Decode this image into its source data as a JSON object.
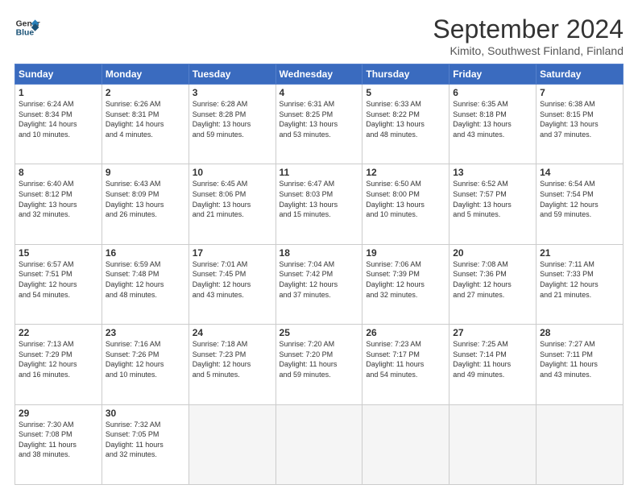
{
  "header": {
    "logo_line1": "General",
    "logo_line2": "Blue",
    "month_title": "September 2024",
    "subtitle": "Kimito, Southwest Finland, Finland"
  },
  "days_of_week": [
    "Sunday",
    "Monday",
    "Tuesday",
    "Wednesday",
    "Thursday",
    "Friday",
    "Saturday"
  ],
  "weeks": [
    [
      {
        "num": "1",
        "info": "Sunrise: 6:24 AM\nSunset: 8:34 PM\nDaylight: 14 hours\nand 10 minutes."
      },
      {
        "num": "2",
        "info": "Sunrise: 6:26 AM\nSunset: 8:31 PM\nDaylight: 14 hours\nand 4 minutes."
      },
      {
        "num": "3",
        "info": "Sunrise: 6:28 AM\nSunset: 8:28 PM\nDaylight: 13 hours\nand 59 minutes."
      },
      {
        "num": "4",
        "info": "Sunrise: 6:31 AM\nSunset: 8:25 PM\nDaylight: 13 hours\nand 53 minutes."
      },
      {
        "num": "5",
        "info": "Sunrise: 6:33 AM\nSunset: 8:22 PM\nDaylight: 13 hours\nand 48 minutes."
      },
      {
        "num": "6",
        "info": "Sunrise: 6:35 AM\nSunset: 8:18 PM\nDaylight: 13 hours\nand 43 minutes."
      },
      {
        "num": "7",
        "info": "Sunrise: 6:38 AM\nSunset: 8:15 PM\nDaylight: 13 hours\nand 37 minutes."
      }
    ],
    [
      {
        "num": "8",
        "info": "Sunrise: 6:40 AM\nSunset: 8:12 PM\nDaylight: 13 hours\nand 32 minutes."
      },
      {
        "num": "9",
        "info": "Sunrise: 6:43 AM\nSunset: 8:09 PM\nDaylight: 13 hours\nand 26 minutes."
      },
      {
        "num": "10",
        "info": "Sunrise: 6:45 AM\nSunset: 8:06 PM\nDaylight: 13 hours\nand 21 minutes."
      },
      {
        "num": "11",
        "info": "Sunrise: 6:47 AM\nSunset: 8:03 PM\nDaylight: 13 hours\nand 15 minutes."
      },
      {
        "num": "12",
        "info": "Sunrise: 6:50 AM\nSunset: 8:00 PM\nDaylight: 13 hours\nand 10 minutes."
      },
      {
        "num": "13",
        "info": "Sunrise: 6:52 AM\nSunset: 7:57 PM\nDaylight: 13 hours\nand 5 minutes."
      },
      {
        "num": "14",
        "info": "Sunrise: 6:54 AM\nSunset: 7:54 PM\nDaylight: 12 hours\nand 59 minutes."
      }
    ],
    [
      {
        "num": "15",
        "info": "Sunrise: 6:57 AM\nSunset: 7:51 PM\nDaylight: 12 hours\nand 54 minutes."
      },
      {
        "num": "16",
        "info": "Sunrise: 6:59 AM\nSunset: 7:48 PM\nDaylight: 12 hours\nand 48 minutes."
      },
      {
        "num": "17",
        "info": "Sunrise: 7:01 AM\nSunset: 7:45 PM\nDaylight: 12 hours\nand 43 minutes."
      },
      {
        "num": "18",
        "info": "Sunrise: 7:04 AM\nSunset: 7:42 PM\nDaylight: 12 hours\nand 37 minutes."
      },
      {
        "num": "19",
        "info": "Sunrise: 7:06 AM\nSunset: 7:39 PM\nDaylight: 12 hours\nand 32 minutes."
      },
      {
        "num": "20",
        "info": "Sunrise: 7:08 AM\nSunset: 7:36 PM\nDaylight: 12 hours\nand 27 minutes."
      },
      {
        "num": "21",
        "info": "Sunrise: 7:11 AM\nSunset: 7:33 PM\nDaylight: 12 hours\nand 21 minutes."
      }
    ],
    [
      {
        "num": "22",
        "info": "Sunrise: 7:13 AM\nSunset: 7:29 PM\nDaylight: 12 hours\nand 16 minutes."
      },
      {
        "num": "23",
        "info": "Sunrise: 7:16 AM\nSunset: 7:26 PM\nDaylight: 12 hours\nand 10 minutes."
      },
      {
        "num": "24",
        "info": "Sunrise: 7:18 AM\nSunset: 7:23 PM\nDaylight: 12 hours\nand 5 minutes."
      },
      {
        "num": "25",
        "info": "Sunrise: 7:20 AM\nSunset: 7:20 PM\nDaylight: 11 hours\nand 59 minutes."
      },
      {
        "num": "26",
        "info": "Sunrise: 7:23 AM\nSunset: 7:17 PM\nDaylight: 11 hours\nand 54 minutes."
      },
      {
        "num": "27",
        "info": "Sunrise: 7:25 AM\nSunset: 7:14 PM\nDaylight: 11 hours\nand 49 minutes."
      },
      {
        "num": "28",
        "info": "Sunrise: 7:27 AM\nSunset: 7:11 PM\nDaylight: 11 hours\nand 43 minutes."
      }
    ],
    [
      {
        "num": "29",
        "info": "Sunrise: 7:30 AM\nSunset: 7:08 PM\nDaylight: 11 hours\nand 38 minutes."
      },
      {
        "num": "30",
        "info": "Sunrise: 7:32 AM\nSunset: 7:05 PM\nDaylight: 11 hours\nand 32 minutes."
      },
      {
        "num": "",
        "info": ""
      },
      {
        "num": "",
        "info": ""
      },
      {
        "num": "",
        "info": ""
      },
      {
        "num": "",
        "info": ""
      },
      {
        "num": "",
        "info": ""
      }
    ]
  ]
}
